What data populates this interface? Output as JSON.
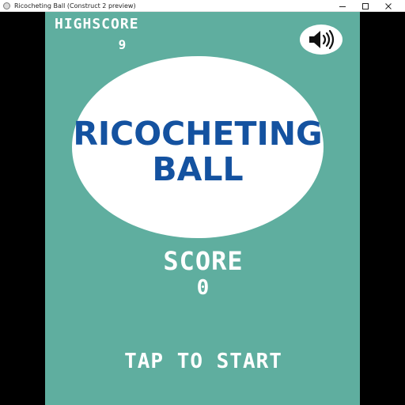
{
  "window": {
    "title": "Ricocheting Ball (Construct 2 preview)",
    "controls": {
      "minimize_icon": "minimize-icon",
      "maximize_icon": "maximize-icon",
      "close_icon": "close-icon"
    }
  },
  "game": {
    "background_color": "#5fae9f",
    "title_color": "#1452a0",
    "highscore_label": "HIGHSCORE",
    "highscore_value": "9",
    "title_line1": "RICOCHETING",
    "title_line2": "BALL",
    "score_label": "SCORE",
    "score_value": "0",
    "start_prompt": "TAP TO START",
    "sound_icon": "speaker-icon"
  }
}
